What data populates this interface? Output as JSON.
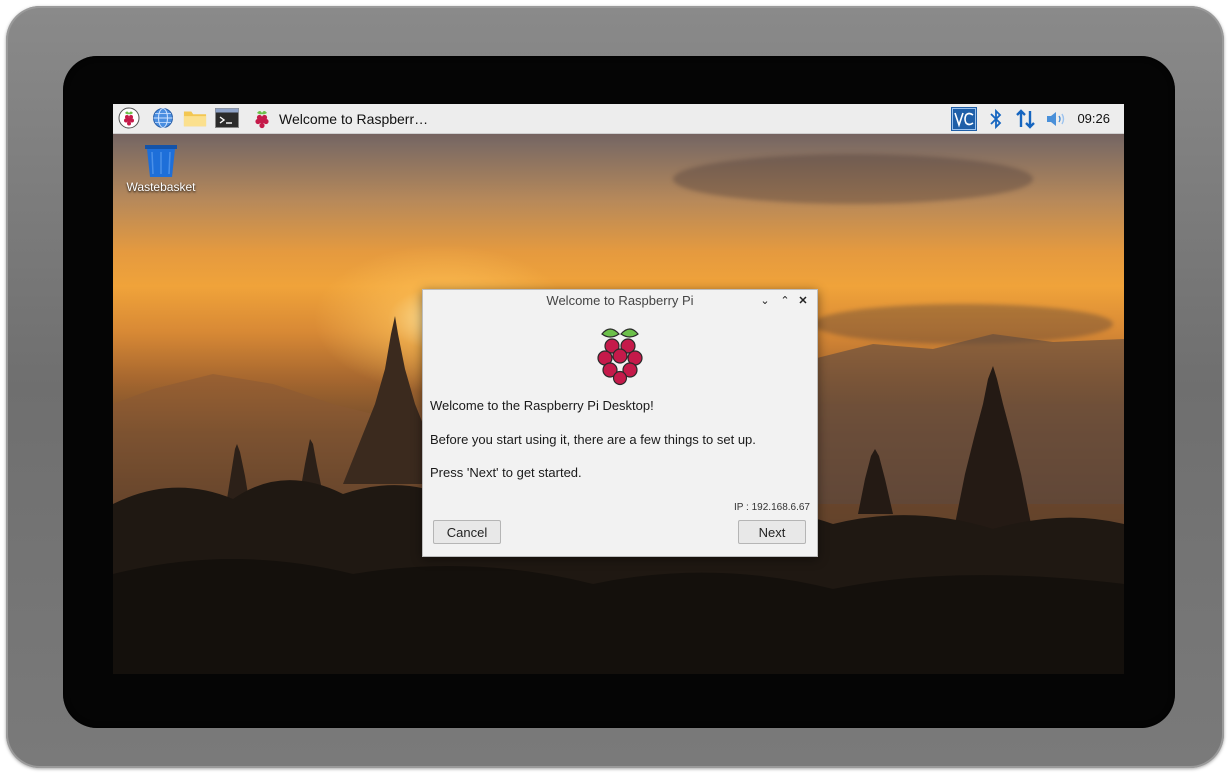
{
  "taskbar": {
    "window_title": "Welcome to Raspberr…",
    "clock": "09:26",
    "icons": [
      "raspberry-menu-icon",
      "globe-icon",
      "folder-icon",
      "terminal-icon"
    ],
    "tray_icons": [
      "vnc-icon",
      "bluetooth-icon",
      "network-icon",
      "volume-icon"
    ]
  },
  "desktop": {
    "icons": [
      {
        "label": "Wastebasket",
        "icon": "wastebasket-icon"
      }
    ]
  },
  "dialog": {
    "title": "Welcome to Raspberry Pi",
    "line1": "Welcome to the Raspberry Pi Desktop!",
    "line2": "Before you start using it, there are a few things to set up.",
    "line3": "Press 'Next' to get started.",
    "ip": "IP : 192.168.6.67",
    "cancel_label": "Cancel",
    "next_label": "Next"
  },
  "colors": {
    "raspberry_red": "#c51a4a",
    "leaf_green": "#6cc04a",
    "vnc_blue": "#1f5fa8",
    "bluetooth_blue": "#1565c0",
    "trash_blue": "#1e6fd9"
  }
}
